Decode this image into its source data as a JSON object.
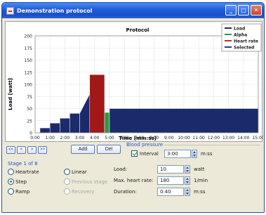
{
  "window": {
    "title": "Demonstration protocol"
  },
  "chart_data": {
    "type": "area",
    "title": "Protocol",
    "xlabel": "Time [mm:ss]",
    "ylabel": "Load [watt]",
    "x_ticks": [
      "0:00",
      "1:00",
      "2:00",
      "3:00",
      "4:00",
      "5:00",
      "6:00",
      "7:00",
      "8:00",
      "9:00",
      "10:00",
      "11:00",
      "12:00",
      "13:00",
      "14:00",
      "15:00"
    ],
    "y_ticks": [
      "0",
      "25",
      "50",
      "75",
      "100",
      "125",
      "150",
      "175",
      "200"
    ],
    "xlim_min": [
      0,
      15
    ],
    "ylim": [
      0,
      200
    ],
    "grid": true,
    "legend_position": "top-right",
    "legend": [
      {
        "label": "Load",
        "color": "#1a2a6a"
      },
      {
        "label": "Alpha",
        "color": "#2a9a48"
      },
      {
        "label": "Heart rate",
        "color": "#c83020"
      },
      {
        "label": "Selected",
        "color": "#2a3a90"
      }
    ],
    "segments": [
      {
        "series": "Load",
        "shape": "step",
        "x_start": 0.33,
        "x_end": 1.0,
        "y_start": 10,
        "y_end": 10
      },
      {
        "series": "Load",
        "shape": "step",
        "x_start": 1.0,
        "x_end": 1.67,
        "y_start": 20,
        "y_end": 20
      },
      {
        "series": "Load",
        "shape": "step",
        "x_start": 1.67,
        "x_end": 2.33,
        "y_start": 30,
        "y_end": 30
      },
      {
        "series": "Load",
        "shape": "step",
        "x_start": 2.33,
        "x_end": 3.0,
        "y_start": 40,
        "y_end": 40
      },
      {
        "series": "Load",
        "shape": "ramp",
        "x_start": 3.0,
        "x_end": 3.67,
        "y_start": 40,
        "y_end": 80
      },
      {
        "series": "Heart rate",
        "shape": "step",
        "x_start": 3.67,
        "x_end": 4.67,
        "y_start": 120,
        "y_end": 120
      },
      {
        "series": "Alpha",
        "shape": "step",
        "x_start": 4.67,
        "x_end": 5.0,
        "y_start": 42,
        "y_end": 42
      },
      {
        "series": "Load",
        "shape": "step",
        "x_start": 5.0,
        "x_end": 15.0,
        "y_start": 50,
        "y_end": 50
      }
    ]
  },
  "nav": {
    "first": "<<",
    "prev": "<",
    "next": ">",
    "last": ">>",
    "add": "Add",
    "del": "Del"
  },
  "blood_pressure": {
    "legend": "Blood pressure",
    "interval_checked": true,
    "interval_label": "Interval",
    "interval_value": "3:00",
    "interval_unit": "m:ss"
  },
  "stage": {
    "label": "Stage 1 of 8",
    "type_options": [
      {
        "label": "Heartrate",
        "selected": false
      },
      {
        "label": "Step",
        "selected": true
      },
      {
        "label": "Ramp",
        "selected": false
      }
    ],
    "mode_options": [
      {
        "label": "Linear",
        "selected": false,
        "disabled": false
      },
      {
        "label": "Previous stage",
        "selected": false,
        "disabled": true
      },
      {
        "label": "Recovery",
        "selected": false,
        "disabled": true
      }
    ]
  },
  "params": {
    "load": {
      "label": "Load:",
      "value": "10",
      "unit": "watt"
    },
    "max_hr": {
      "label": "Max. heart rate:",
      "value": "180",
      "unit": "1/min"
    },
    "duration": {
      "label": "Duration:",
      "value": "0:40",
      "unit": "m:ss"
    }
  },
  "colors": {
    "load_fill": "#1a2a6a",
    "alpha_fill": "#2a9a48",
    "heart_rate_fill": "#a01818",
    "grid": "#c8c8c8",
    "group_label": "#2050c0"
  }
}
